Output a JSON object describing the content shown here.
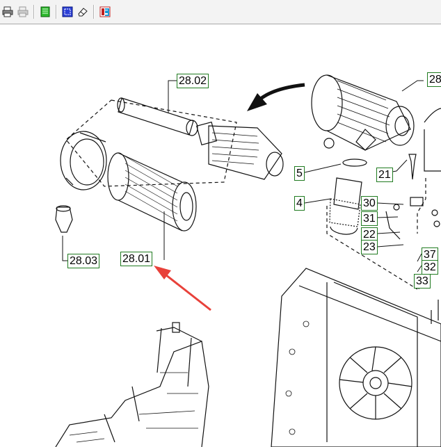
{
  "toolbar": {
    "buttons": [
      {
        "icon": "print-icon"
      },
      {
        "icon": "print-preview-icon"
      },
      {
        "icon": "green-page-icon"
      },
      {
        "icon": "select-area-icon"
      },
      {
        "icon": "eraser-icon"
      },
      {
        "icon": "flag-document-icon"
      }
    ]
  },
  "callouts": {
    "c2802": "28.02",
    "c28": "28",
    "c2803": "28.03",
    "c2801": "28.01",
    "c5": "5",
    "c21": "21",
    "c4": "4",
    "c30": "30",
    "c31": "31",
    "c22": "22",
    "c23": "23",
    "c37": "37",
    "c32": "32",
    "c33": "33"
  },
  "colors": {
    "callout_border": "#1f7a1f",
    "pointer_arrow": "#e8413a",
    "toolbar_bg": "#f3f3f3"
  }
}
